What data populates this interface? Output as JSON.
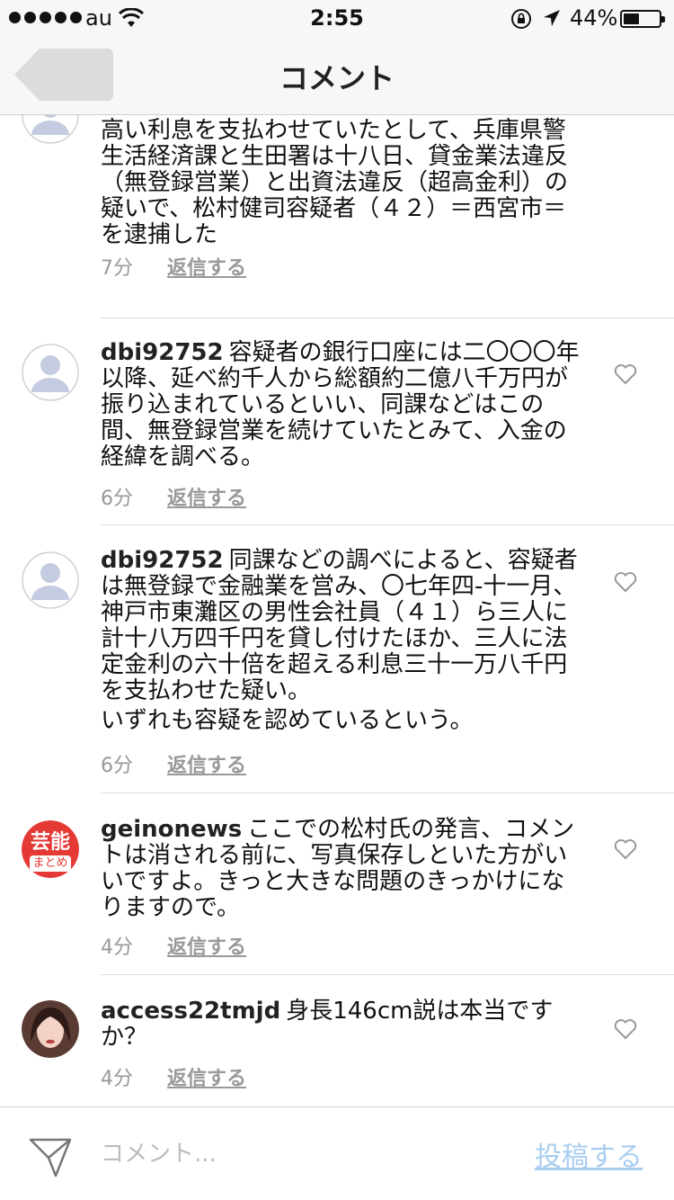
{
  "status_bar": {
    "carrier": "au",
    "time": "2:55",
    "battery_percent_text": "44%",
    "battery_level": 0.44
  },
  "nav": {
    "title": "コメント"
  },
  "comments": [
    {
      "username": "",
      "text": "話を使った貸金業を無登録で営み、法定より高い利息を支払わせていたとして、兵庫県警生活経済課と生田署は十八日、貸金業法違反（無登録営業）と出資法違反（超高金利）の疑いで、松村健司容疑者（４２）＝西宮市＝を逮捕した",
      "extra": "",
      "time": "7分",
      "reply": "返信する",
      "avatar": "default-avatar"
    },
    {
      "username": "dbi92752",
      "text": "容疑者の銀行口座には二〇〇〇年以降、延べ約千人から総額約二億八千万円が振り込まれているといい、同課などはこの間、無登録営業を続けていたとみて、入金の経緯を調べる。",
      "extra": "",
      "time": "6分",
      "reply": "返信する",
      "avatar": "default-avatar"
    },
    {
      "username": "dbi92752",
      "text": "同課などの調べによると、容疑者は無登録で金融業を営み、〇七年四-十一月、神戸市東灘区の男性会社員（４１）ら三人に計十八万四千円を貸し付けたほか、三人に法定金利の六十倍を超える利息三十一万八千円を支払わせた疑い。",
      "extra": "いずれも容疑を認めているという。",
      "time": "6分",
      "reply": "返信する",
      "avatar": "default-avatar"
    },
    {
      "username": "geinonews",
      "text": "ここでの松村氏の発言、コメントは消される前に、写真保存しといた方がいいですよ。きっと大きな問題のきっかけになりますので。",
      "extra": "",
      "time": "4分",
      "reply": "返信する",
      "avatar": "geino-badge",
      "badge_big": "芸能",
      "badge_small": "まとめ"
    },
    {
      "username": "access22tmjd",
      "text": "身長146cm説は本当ですか？",
      "extra": "",
      "time": "4分",
      "reply": "返信する",
      "avatar": "photo-avatar"
    }
  ],
  "input_bar": {
    "placeholder": "コメント...",
    "post_label": "投稿する"
  },
  "colors": {
    "post_button": "#a8cdf0",
    "badge_red": "#e53935",
    "avatar_default": "#c5cbe0",
    "meta_gray": "#999999"
  }
}
